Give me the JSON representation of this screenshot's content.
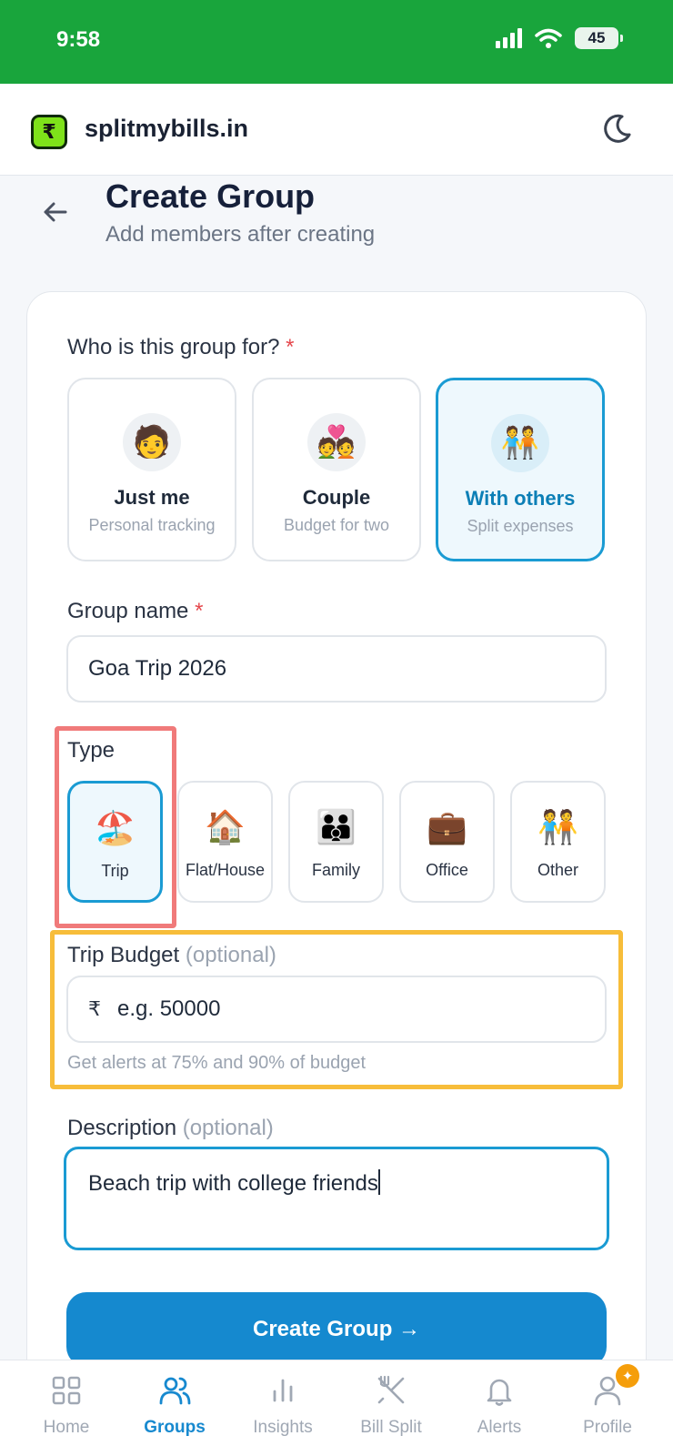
{
  "status": {
    "time": "9:58",
    "battery": "45"
  },
  "header": {
    "brand": "splitmybills.in",
    "logo_symbol": "₹"
  },
  "page": {
    "title": "Create Group",
    "subtitle": "Add members after creating"
  },
  "who": {
    "label": "Who is this group for?",
    "required_mark": "*",
    "options": [
      {
        "emoji": "🧑",
        "title": "Just me",
        "subtitle": "Personal tracking"
      },
      {
        "emoji": "💑",
        "title": "Couple",
        "subtitle": "Budget for two"
      },
      {
        "emoji": "🧑‍🤝‍🧑",
        "title": "With others",
        "subtitle": "Split expenses"
      }
    ],
    "selected": "With others"
  },
  "group_name": {
    "label": "Group name",
    "required_mark": "*",
    "value": "Goa Trip 2026"
  },
  "type": {
    "label": "Type",
    "options": [
      {
        "emoji": "🏖️",
        "label": "Trip"
      },
      {
        "emoji": "🏠",
        "label": "Flat/House"
      },
      {
        "emoji": "👪",
        "label": "Family"
      },
      {
        "emoji": "💼",
        "label": "Office"
      },
      {
        "emoji": "🧑‍🤝‍🧑",
        "label": "Other"
      }
    ],
    "selected": "Trip"
  },
  "budget": {
    "label": "Trip Budget",
    "optional": "(optional)",
    "currency": "₹",
    "placeholder": "e.g. 50000",
    "hint": "Get alerts at 75% and 90% of budget"
  },
  "description": {
    "label": "Description",
    "optional": "(optional)",
    "value": "Beach trip with college friends"
  },
  "create_button": "Create Group →",
  "nav": {
    "items": [
      {
        "label": "Home",
        "icon": "home-grid-icon"
      },
      {
        "label": "Groups",
        "icon": "users-icon"
      },
      {
        "label": "Insights",
        "icon": "bar-chart-icon"
      },
      {
        "label": "Bill Split",
        "icon": "utensils-icon"
      },
      {
        "label": "Alerts",
        "icon": "bell-icon"
      },
      {
        "label": "Profile",
        "icon": "user-icon"
      }
    ],
    "active": "Groups"
  },
  "colors": {
    "status_bar": "#19a53c",
    "accent": "#1589cf",
    "logo": "#7ee21a",
    "highlight_red": "#f07a7a",
    "highlight_yellow": "#f7bd3a"
  }
}
